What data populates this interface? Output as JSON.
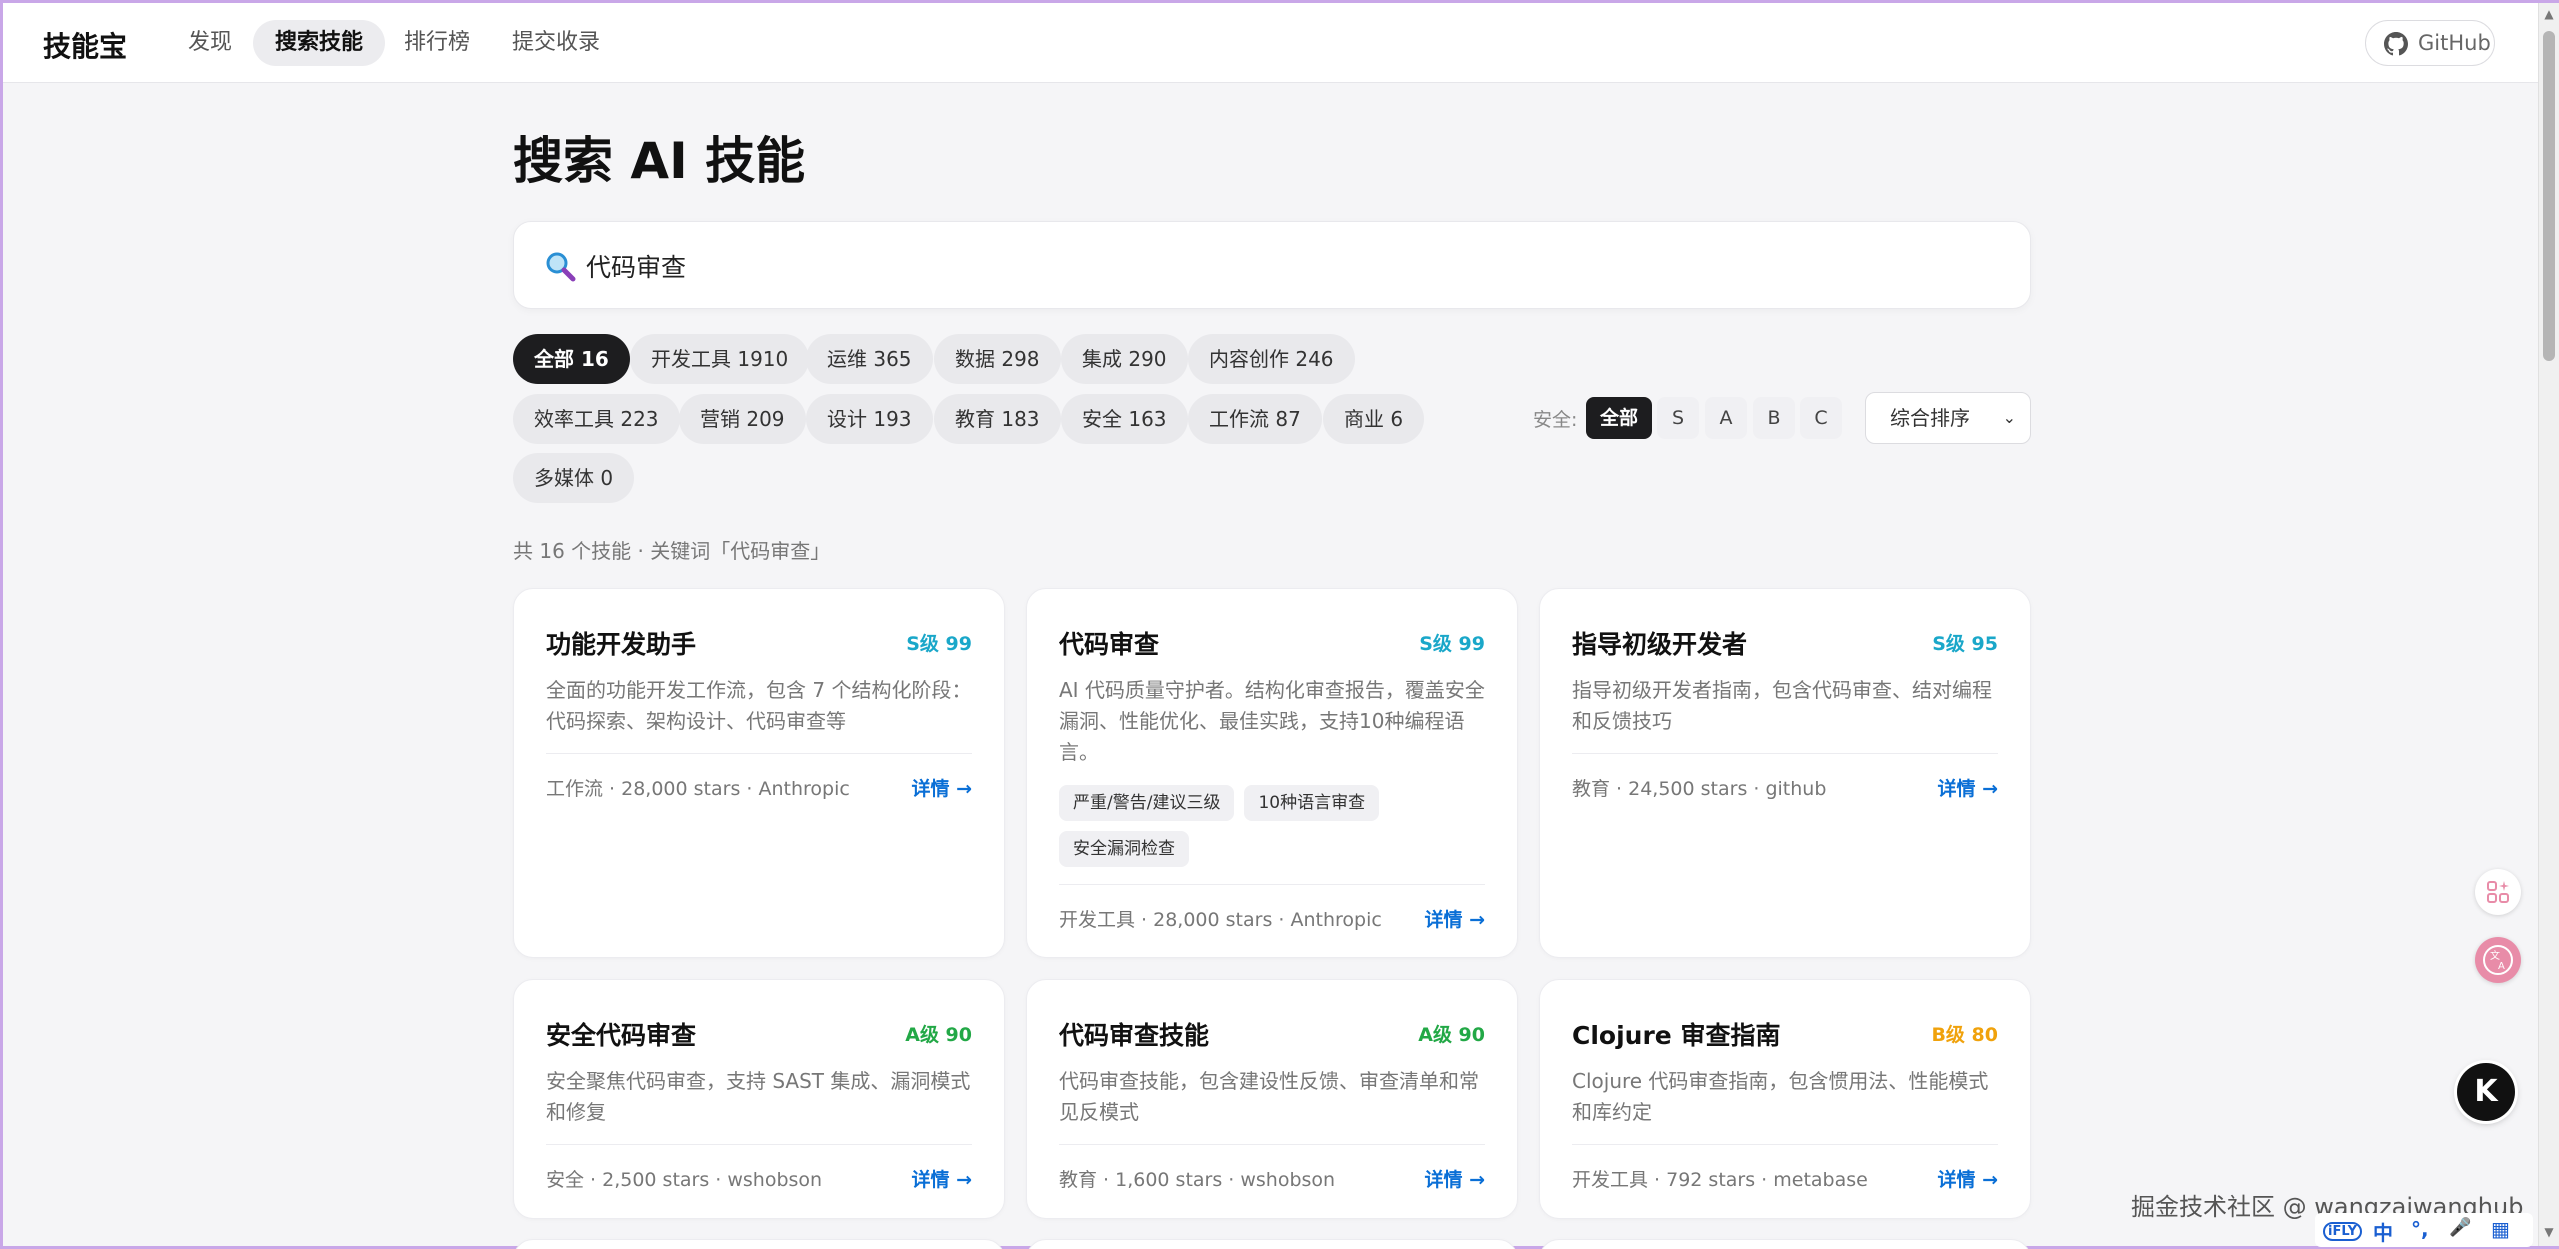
{
  "nav": {
    "brand": "技能宝",
    "items": [
      {
        "label": "发现",
        "active": false
      },
      {
        "label": "搜索技能",
        "active": true
      },
      {
        "label": "排行榜",
        "active": false
      },
      {
        "label": "提交收录",
        "active": false
      }
    ],
    "github_label": "GitHub"
  },
  "page": {
    "title": "搜索 AI 技能"
  },
  "search": {
    "icon": "magnifier-icon",
    "value": "代码审查"
  },
  "categories": [
    {
      "label": "全部 16",
      "active": true
    },
    {
      "label": "开发工具 1910"
    },
    {
      "label": "运维 365"
    },
    {
      "label": "数据 298"
    },
    {
      "label": "集成 290"
    },
    {
      "label": "内容创作 246"
    },
    {
      "label": "效率工具 223"
    },
    {
      "label": "营销 209"
    },
    {
      "label": "设计 193"
    },
    {
      "label": "教育 183"
    },
    {
      "label": "安全 163"
    },
    {
      "label": "工作流 87"
    },
    {
      "label": "商业 6"
    },
    {
      "label": "多媒体 0"
    }
  ],
  "security_filter": {
    "label": "安全:",
    "options": [
      {
        "label": "全部",
        "active": true
      },
      {
        "label": "S"
      },
      {
        "label": "A"
      },
      {
        "label": "B"
      },
      {
        "label": "C"
      }
    ]
  },
  "sort": {
    "selected": "综合排序"
  },
  "summary": "共 16 个技能 · 关键词「代码审查」",
  "cards": [
    {
      "title": "功能开发助手",
      "grade": "S级 99",
      "grade_color": "#1aa7c9",
      "desc": "全面的功能开发工作流，包含 7 个结构化阶段：代码探索、架构设计、代码审查等",
      "tags": [],
      "meta": "工作流 · 28,000 stars · Anthropic",
      "detail": "详情 →"
    },
    {
      "title": "代码审查",
      "grade": "S级 99",
      "grade_color": "#1aa7c9",
      "desc": "AI 代码质量守护者。结构化审查报告，覆盖安全漏洞、性能优化、最佳实践，支持10种编程语言。",
      "tags": [
        "严重/警告/建议三级",
        "10种语言审查",
        "安全漏洞检查"
      ],
      "meta": "开发工具 · 28,000 stars · Anthropic",
      "detail": "详情 →"
    },
    {
      "title": "指导初级开发者",
      "grade": "S级 95",
      "grade_color": "#1aa7c9",
      "desc": "指导初级开发者指南，包含代码审查、结对编程和反馈技巧",
      "tags": [],
      "meta": "教育 · 24,500 stars · github",
      "detail": "详情 →"
    },
    {
      "title": "安全代码审查",
      "grade": "A级 90",
      "grade_color": "#22a846",
      "desc": "安全聚焦代码审查，支持 SAST 集成、漏洞模式和修复",
      "tags": [],
      "meta": "安全 · 2,500 stars · wshobson",
      "detail": "详情 →"
    },
    {
      "title": "代码审查技能",
      "grade": "A级 90",
      "grade_color": "#22a846",
      "desc": "代码审查技能，包含建设性反馈、审查清单和常见反模式",
      "tags": [],
      "meta": "教育 · 1,600 stars · wshobson",
      "detail": "详情 →"
    },
    {
      "title": "Clojure 审查指南",
      "grade": "B级 80",
      "grade_color": "#f0a20c",
      "desc": "Clojure 代码审查指南，包含惯用法、性能模式和库约定",
      "tags": [],
      "meta": "开发工具 · 792 stars · metabase",
      "detail": "详情 →"
    }
  ],
  "overlay": {
    "watermark": "掘金技术社区 @ wangzaiwanghub",
    "k_badge": "K",
    "ime_items": [
      "iFLY",
      "中",
      "°,",
      "🎤",
      "▦"
    ]
  }
}
